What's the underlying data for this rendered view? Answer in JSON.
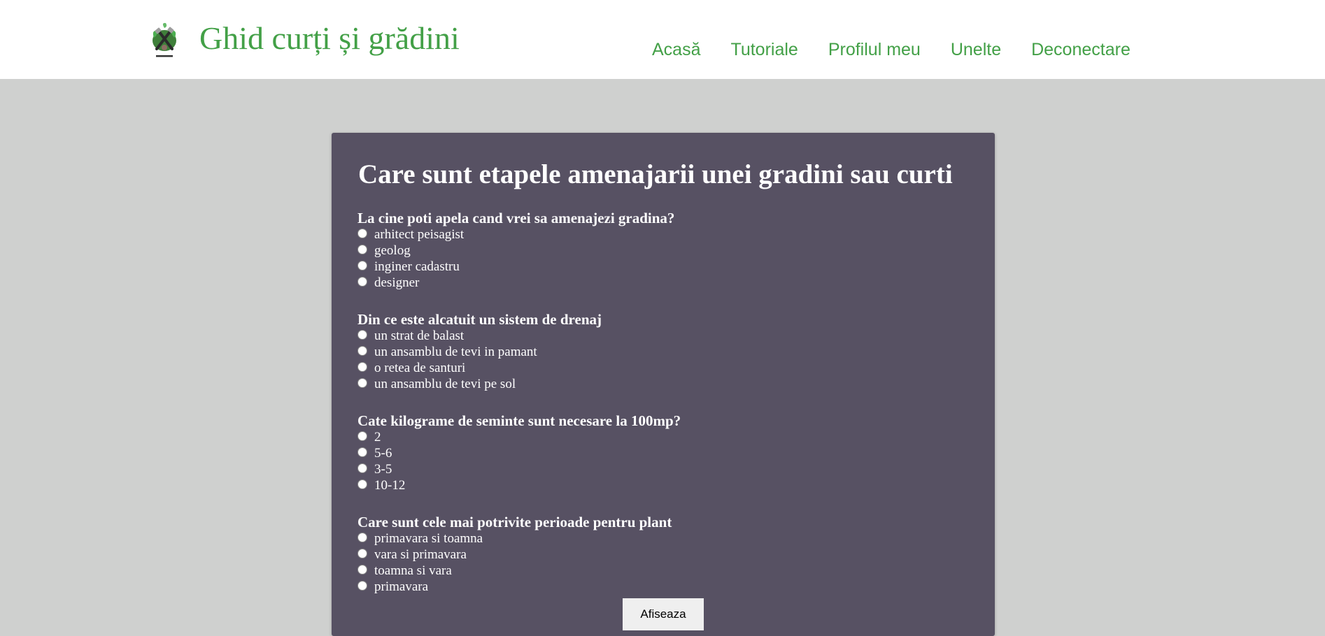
{
  "header": {
    "site_title": "Ghid curți și grădini",
    "logo_icon": "gardening-tools-logo-icon",
    "nav": [
      {
        "label": "Acasă"
      },
      {
        "label": "Tutoriale"
      },
      {
        "label": "Profilul meu"
      },
      {
        "label": "Unelte"
      },
      {
        "label": "Deconectare"
      }
    ]
  },
  "quiz": {
    "title": "Care sunt etapele amenajarii unei gradini sau curti",
    "questions": [
      {
        "text": "La cine poti apela cand vrei sa amenajezi gradina?",
        "options": [
          "arhitect peisagist",
          "geolog",
          "inginer cadastru",
          "designer"
        ]
      },
      {
        "text": "Din ce este alcatuit un sistem de drenaj",
        "options": [
          "un strat de balast",
          "un ansamblu de tevi in pamant",
          "o retea de santuri",
          "un ansamblu de tevi pe sol"
        ]
      },
      {
        "text": "Cate kilograme de seminte sunt necesare la 100mp?",
        "options": [
          "2",
          "5-6",
          "3-5",
          "10-12"
        ]
      },
      {
        "text": "Care sunt cele mai potrivite perioade pentru plant",
        "options": [
          "primavara si toamna",
          "vara si primavara",
          "toamna si vara",
          "primavara"
        ]
      }
    ],
    "submit_label": "Afiseaza"
  },
  "colors": {
    "accent": "#43a047",
    "card_background": "#575163",
    "page_background": "#cfd0cf"
  }
}
